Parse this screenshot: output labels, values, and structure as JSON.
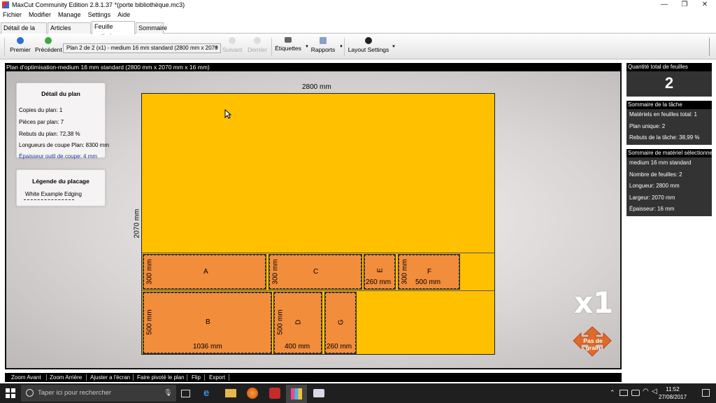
{
  "window": {
    "title": "MaxCut Community Edition 2.8.1.37 *(porte bibliothèque.mc3)",
    "controls": {
      "minimize": "—",
      "restore": "❐",
      "close": "✕"
    }
  },
  "menu": [
    "Fichier",
    "Modifier",
    "Manage",
    "Settings",
    "Aide"
  ],
  "tabs": [
    "Détail de la tâche",
    "Articles d'entrée",
    "Feuille optimiser",
    "Sommaire"
  ],
  "toolbar": {
    "first": "Premier",
    "prev": "Précédent",
    "plan_select": "Plan 2 de 2 (x1) - medium 16 mm standard (2800 mm x 2070",
    "next": "Suivant",
    "last": "Dernier",
    "labels": "Étiquettes",
    "reports": "Rapports",
    "layout": "Layout Settings"
  },
  "main": {
    "header": "Plan d'optimisation-medium 16 mm standard (2800 mm x 2070 mm x 16 mm)",
    "plan_detail": {
      "title": "Détail du plan",
      "lines": [
        "Copies du plan: 1",
        "Pièces par plan: 7",
        "Rebuts du plan: 72,38 %",
        "Longueurs de coupe Plan: 8300 mm"
      ],
      "tool": "Épaisseur outil de coupe: 4 mm"
    },
    "legend": {
      "title": "Légende du placage",
      "item": "White Example Edging"
    },
    "sheet": {
      "width_label": "2800 mm",
      "height_label": "2070 mm"
    },
    "pieces": {
      "A": {
        "name": "A",
        "h": "300 mm"
      },
      "C": {
        "name": "C",
        "h": "300 mm"
      },
      "E": {
        "name": "E",
        "w": "260 mm"
      },
      "F": {
        "name": "F",
        "h": "300 mm",
        "w": "500 mm"
      },
      "B": {
        "name": "B",
        "h": "500 mm",
        "w": "1036 mm"
      },
      "D": {
        "name": "D",
        "h": "500 mm",
        "w": "400 mm"
      },
      "G": {
        "name": "G",
        "w": "260 mm"
      }
    },
    "multiplier": "x1",
    "grain": "Pas de grain"
  },
  "right": {
    "total": {
      "title": "Quantité total de feuilles",
      "value": "2"
    },
    "task": {
      "title": "Sommaire de la tâche",
      "lines": [
        "Matériels en feuilles total: 1",
        "Plan unique: 2",
        "Rebuts de la tâche: 38,99 %"
      ]
    },
    "material": {
      "title": "Sommaire de matériel sélectionner",
      "lines": [
        "medium 16 mm standard",
        "Nombre de feuilles: 2",
        "Longueur: 2800 mm",
        "Largeur: 2070 mm",
        "Épaisseur: 16 mm"
      ]
    }
  },
  "actions": [
    "Zoom Avant",
    "Zoom Arrière",
    "Ajuster a l'écran",
    "Faire pivoté le plan",
    "Flip",
    "Export"
  ],
  "taskbar": {
    "search_placeholder": "Taper ici pour rechercher",
    "time": "11:52",
    "date": "27/08/2017"
  },
  "colors": {
    "sheet": "#ffc000",
    "piece": "#f28d3c",
    "panel_bg": "#333333",
    "header_bg": "#000000"
  }
}
